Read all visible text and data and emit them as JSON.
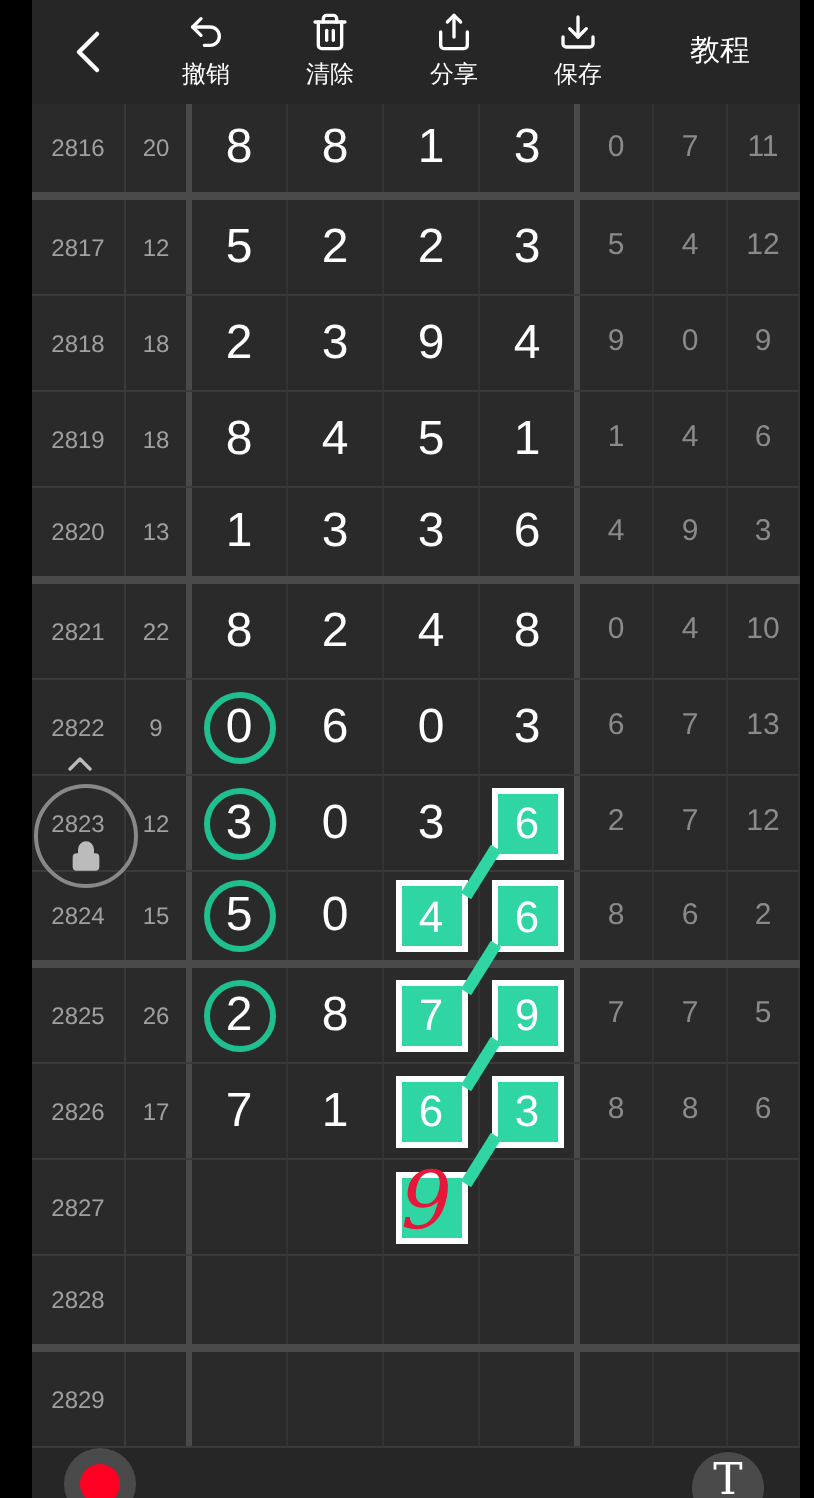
{
  "toolbar": {
    "items": [
      {
        "kind": "undo",
        "label": "撤销"
      },
      {
        "kind": "clear",
        "label": "清除"
      },
      {
        "kind": "share",
        "label": "分享"
      },
      {
        "kind": "save",
        "label": "保存"
      }
    ],
    "tutorial": "教程"
  },
  "rows": [
    {
      "issue": "2816",
      "sum": "20",
      "digits": [
        {
          "value": "8",
          "kind": "plain"
        },
        {
          "value": "8",
          "kind": "plain"
        },
        {
          "value": "1",
          "kind": "plain"
        },
        {
          "value": "3",
          "kind": "plain"
        }
      ],
      "extra": [
        "0",
        "7",
        "11"
      ],
      "group_end": true
    },
    {
      "issue": "2817",
      "sum": "12",
      "digits": [
        {
          "value": "5",
          "kind": "plain"
        },
        {
          "value": "2",
          "kind": "plain"
        },
        {
          "value": "2",
          "kind": "plain"
        },
        {
          "value": "3",
          "kind": "plain"
        }
      ],
      "extra": [
        "5",
        "4",
        "12"
      ],
      "group_end": false
    },
    {
      "issue": "2818",
      "sum": "18",
      "digits": [
        {
          "value": "2",
          "kind": "plain"
        },
        {
          "value": "3",
          "kind": "plain"
        },
        {
          "value": "9",
          "kind": "plain"
        },
        {
          "value": "4",
          "kind": "plain"
        }
      ],
      "extra": [
        "9",
        "0",
        "9"
      ],
      "group_end": false
    },
    {
      "issue": "2819",
      "sum": "18",
      "digits": [
        {
          "value": "8",
          "kind": "plain"
        },
        {
          "value": "4",
          "kind": "plain"
        },
        {
          "value": "5",
          "kind": "plain"
        },
        {
          "value": "1",
          "kind": "plain"
        }
      ],
      "extra": [
        "1",
        "4",
        "6"
      ],
      "group_end": false
    },
    {
      "issue": "2820",
      "sum": "13",
      "digits": [
        {
          "value": "1",
          "kind": "plain"
        },
        {
          "value": "3",
          "kind": "plain"
        },
        {
          "value": "3",
          "kind": "plain"
        },
        {
          "value": "6",
          "kind": "plain"
        }
      ],
      "extra": [
        "4",
        "9",
        "3"
      ],
      "group_end": true
    },
    {
      "issue": "2821",
      "sum": "22",
      "digits": [
        {
          "value": "8",
          "kind": "plain"
        },
        {
          "value": "2",
          "kind": "plain"
        },
        {
          "value": "4",
          "kind": "plain"
        },
        {
          "value": "8",
          "kind": "plain"
        }
      ],
      "extra": [
        "0",
        "4",
        "10"
      ],
      "group_end": false
    },
    {
      "issue": "2822",
      "sum": "9",
      "digits": [
        {
          "value": "0",
          "kind": "circle"
        },
        {
          "value": "6",
          "kind": "plain"
        },
        {
          "value": "0",
          "kind": "plain"
        },
        {
          "value": "3",
          "kind": "plain"
        }
      ],
      "extra": [
        "6",
        "7",
        "13"
      ],
      "group_end": false
    },
    {
      "issue": "2823",
      "sum": "12",
      "digits": [
        {
          "value": "3",
          "kind": "circle"
        },
        {
          "value": "0",
          "kind": "plain"
        },
        {
          "value": "3",
          "kind": "plain"
        },
        {
          "value": "6",
          "kind": "box",
          "link": true
        }
      ],
      "extra": [
        "2",
        "7",
        "12"
      ],
      "group_end": false
    },
    {
      "issue": "2824",
      "sum": "15",
      "digits": [
        {
          "value": "5",
          "kind": "circle"
        },
        {
          "value": "0",
          "kind": "plain"
        },
        {
          "value": "4",
          "kind": "box"
        },
        {
          "value": "6",
          "kind": "box",
          "link": true
        }
      ],
      "extra": [
        "8",
        "6",
        "2"
      ],
      "group_end": true
    },
    {
      "issue": "2825",
      "sum": "26",
      "digits": [
        {
          "value": "2",
          "kind": "circle"
        },
        {
          "value": "8",
          "kind": "plain"
        },
        {
          "value": "7",
          "kind": "box"
        },
        {
          "value": "9",
          "kind": "box",
          "link": true
        }
      ],
      "extra": [
        "7",
        "7",
        "5"
      ],
      "group_end": false
    },
    {
      "issue": "2826",
      "sum": "17",
      "digits": [
        {
          "value": "7",
          "kind": "plain"
        },
        {
          "value": "1",
          "kind": "plain"
        },
        {
          "value": "6",
          "kind": "box"
        },
        {
          "value": "3",
          "kind": "box",
          "link": true
        }
      ],
      "extra": [
        "8",
        "8",
        "6"
      ],
      "group_end": false
    },
    {
      "issue": "2827",
      "digits": [
        {
          "kind": "empty"
        },
        {
          "kind": "empty"
        },
        {
          "kind": "box",
          "handwritten": "9"
        },
        {
          "kind": "empty"
        }
      ],
      "group_end": false
    },
    {
      "issue": "2828",
      "digits": [
        {
          "kind": "empty"
        },
        {
          "kind": "empty"
        },
        {
          "kind": "empty"
        },
        {
          "kind": "empty"
        }
      ],
      "group_end": true
    },
    {
      "issue": "2829",
      "digits": [
        {
          "kind": "empty"
        },
        {
          "kind": "empty"
        },
        {
          "kind": "empty"
        },
        {
          "kind": "empty"
        }
      ],
      "group_end": false
    }
  ],
  "text_tool": "T"
}
